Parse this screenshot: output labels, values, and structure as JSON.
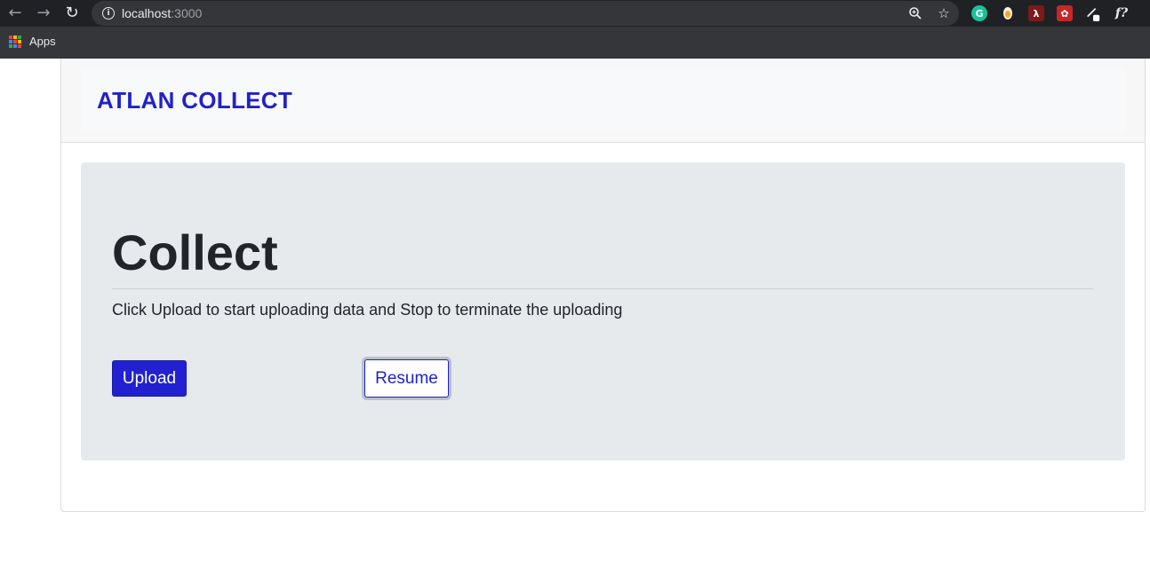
{
  "browser": {
    "url_host": "localhost",
    "url_port": ":3000",
    "bookmarks": {
      "apps_label": "Apps"
    },
    "extensions": [
      {
        "name": "grammarly-icon",
        "glyph": "G",
        "color": "#15c39a"
      },
      {
        "name": "extension-icon",
        "glyph": "●",
        "color": "#f5a623"
      },
      {
        "name": "pdf-icon",
        "glyph": "A",
        "color": "#b71c1c"
      },
      {
        "name": "cookie-icon",
        "glyph": "✿",
        "color": "#c62828"
      },
      {
        "name": "extension-icon-2",
        "glyph": "∕",
        "color": "#e8eaed"
      },
      {
        "name": "font-icon",
        "glyph": "f?",
        "color": "#e8eaed"
      }
    ]
  },
  "header": {
    "brand": "ATLAN COLLECT"
  },
  "jumbotron": {
    "title": "Collect",
    "lead": "Click Upload to start uploading data and Stop to terminate the uploading",
    "upload_label": "Upload",
    "resume_label": "Resume"
  },
  "colors": {
    "brand": "#2121c8",
    "primary_button": "#2121d1",
    "jumbotron_bg": "#e7eaed"
  }
}
